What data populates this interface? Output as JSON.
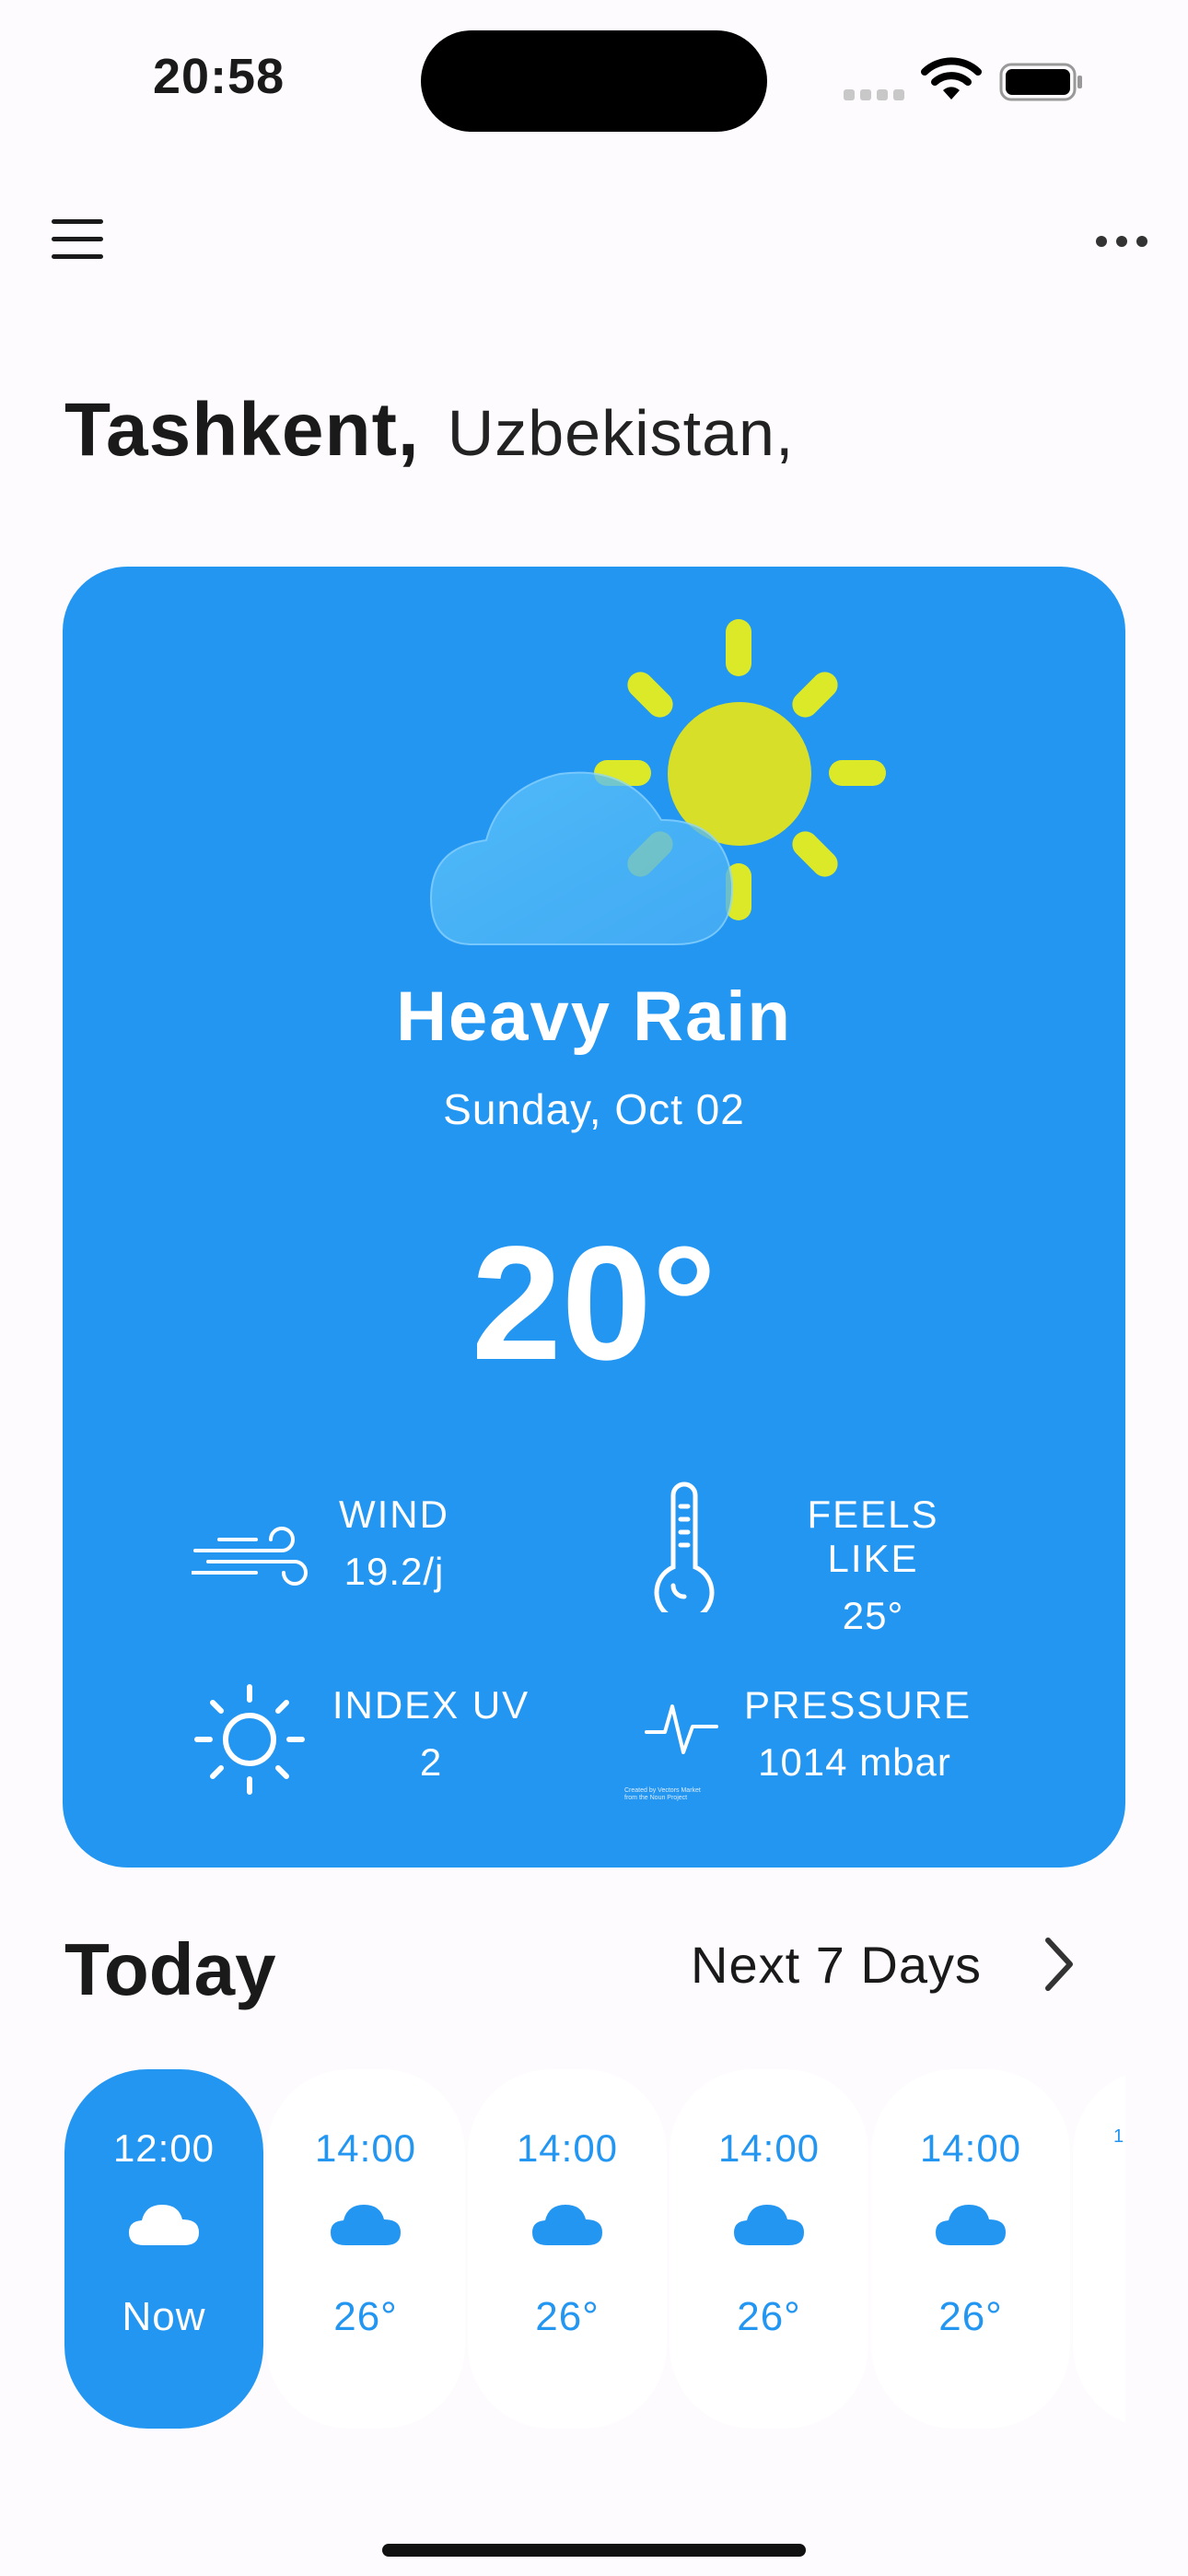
{
  "status_bar": {
    "time": "20:58"
  },
  "location": {
    "city": "Tashkent,",
    "country": "Uzbekistan,"
  },
  "current": {
    "condition": "Heavy Rain",
    "date": "Sunday, Oct 02",
    "temperature": "20°",
    "icon": "partly-cloudy-sun-icon",
    "stats": {
      "wind": {
        "label": "WIND",
        "value": "19.2/j",
        "icon": "wind-icon"
      },
      "feels_like": {
        "label": "FEELS LIKE",
        "value": "25°",
        "icon": "thermometer-icon"
      },
      "uv": {
        "label": "INDEX UV",
        "value": "2",
        "icon": "sun-icon"
      },
      "pressure": {
        "label": "PRESSURE",
        "value": "1014 mbar",
        "icon": "pulse-icon"
      }
    },
    "credit": [
      "Created by Vectors Market",
      "from the Noun Project"
    ]
  },
  "today": {
    "title": "Today",
    "next_link": "Next 7 Days",
    "hours": [
      {
        "time": "12:00",
        "label": "Now",
        "icon": "cloud-icon",
        "active": true
      },
      {
        "time": "14:00",
        "label": "26°",
        "icon": "cloud-icon"
      },
      {
        "time": "14:00",
        "label": "26°",
        "icon": "cloud-icon"
      },
      {
        "time": "14:00",
        "label": "26°",
        "icon": "cloud-icon"
      },
      {
        "time": "14:00",
        "label": "26°",
        "icon": "cloud-icon"
      },
      {
        "time": "1",
        "label": "",
        "icon": ""
      }
    ]
  },
  "colors": {
    "accent": "#2396f2",
    "background": "#fdfbfd",
    "sun": "#e8ec2a"
  }
}
